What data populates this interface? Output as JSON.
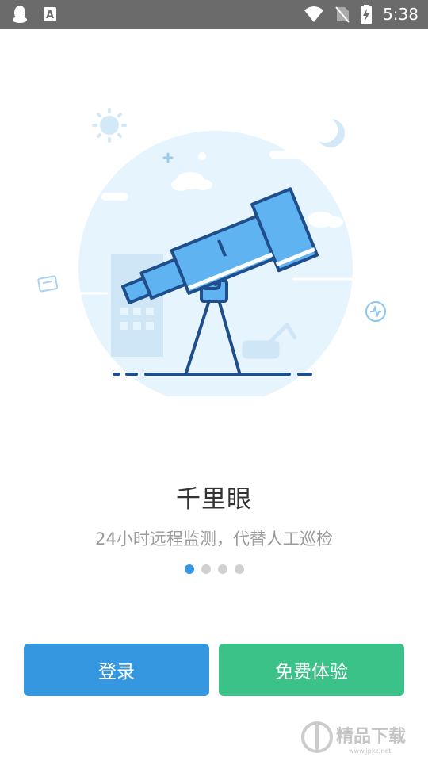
{
  "status_bar": {
    "time": "5:38",
    "left_icons": [
      "qq-penguin-icon",
      "font-a-icon"
    ],
    "right_icons": [
      "wifi-icon",
      "no-sim-icon",
      "battery-charging-icon"
    ]
  },
  "onboarding": {
    "title": "千里眼",
    "subtitle": "24小时远程监测，代替人工巡检",
    "page_count": 4,
    "active_page": 1
  },
  "buttons": {
    "login_label": "登录",
    "trial_label": "免费体验"
  },
  "colors": {
    "primary_blue": "#3497e0",
    "green": "#3ac288",
    "illustration_navy": "#1f4e8c",
    "illustration_light": "#e6f4fd"
  },
  "watermark": {
    "text": "精品下载",
    "url": "www.jpxz.net"
  }
}
